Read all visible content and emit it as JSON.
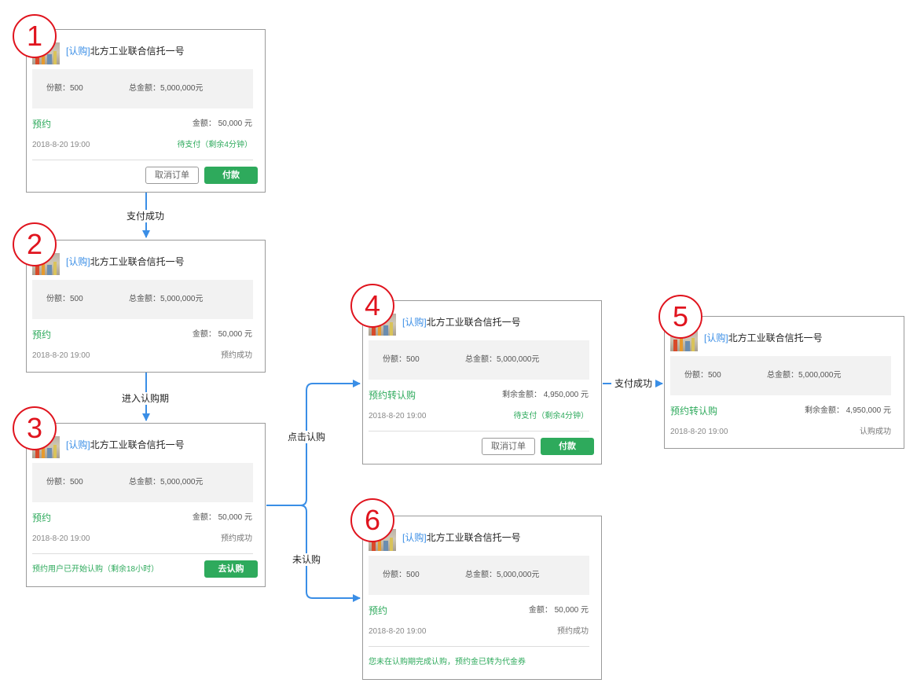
{
  "common": {
    "title_tag": "[认购]",
    "product_name": "北方工业联合信托一号",
    "shares": "份额：500",
    "total_amount": "总金额：5,000,000元",
    "date": "2018-8-20 19:00",
    "cancel_label": "取消订单",
    "pay_label": "付款"
  },
  "cards": {
    "c1": {
      "badge": "1",
      "phase": "预约",
      "amount": "金额：  50,000 元",
      "status": "待支付（剩余4分钟）"
    },
    "c2": {
      "badge": "2",
      "phase": "预约",
      "amount": "金额：  50,000 元",
      "status": "预约成功"
    },
    "c3": {
      "badge": "3",
      "phase": "预约",
      "amount": "金额：  50,000 元",
      "status": "预约成功",
      "note": "预约用户已开始认购（剩余18小时）",
      "action_label": "去认购"
    },
    "c4": {
      "badge": "4",
      "phase": "预约转认购",
      "amount": "剩余金额：  4,950,000 元",
      "status": "待支付（剩余4分钟）"
    },
    "c5": {
      "badge": "5",
      "phase": "预约转认购",
      "amount": "剩余金额：  4,950,000 元",
      "status": "认购成功"
    },
    "c6": {
      "badge": "6",
      "phase": "预约",
      "amount": "金额：  50,000 元",
      "status": "预约成功",
      "note": "您未在认购期完成认购，预约金已转为代金券"
    }
  },
  "transitions": {
    "pay_success": "支付成功",
    "enter_subscription": "进入认购期",
    "click_subscribe": "点击认购",
    "not_subscribed": "未认购"
  },
  "colors": {
    "badge_red": "#e0141e",
    "arrow_blue": "#3a8ee6",
    "success_green": "#2eaa5c"
  }
}
